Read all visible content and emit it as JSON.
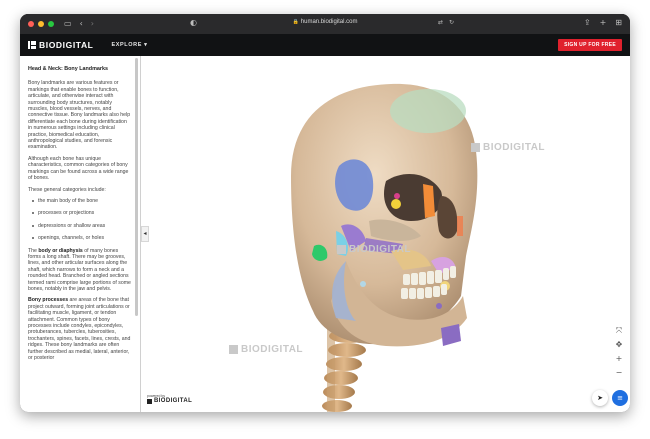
{
  "browser": {
    "url": "human.biodigital.com",
    "traffic_colors": [
      "#ff5f57",
      "#febc2e",
      "#28c840"
    ],
    "icons": [
      "sidebar-toggle-icon",
      "back-icon",
      "forward-icon",
      "shield-icon",
      "translate-icon",
      "reload-icon",
      "share-icon",
      "new-tab-icon",
      "tab-overview-icon"
    ]
  },
  "header": {
    "logo": "BIODIGITAL",
    "explore": "EXPLORE",
    "signup": "SIGN UP FOR FREE",
    "signup_color": "#e0212d"
  },
  "panel": {
    "title": "Head & Neck: Bony Landmarks",
    "p1": "Bony landmarks are various features or markings that enable bones to function, articulate, and otherwise interact with surrounding body structures, notably muscles, blood vessels, nerves, and connective tissue. Bony landmarks also help differentiate each bone during identification in numerous settings including clinical practice, biomedical education, anthropological studies, and forensic examination.",
    "p2": "Although each bone has unique characteristics, common categories of bony markings can be found across a wide range of bones.",
    "p3": "These general categories include:",
    "list": [
      "the main body of the bone",
      "processes or projections",
      "depressions or shallow areas",
      "openings, channels, or holes"
    ],
    "p4_bold": "body or diaphysis",
    "p4_pre": "The ",
    "p4_post": " of many bones forms a long shaft. There may be grooves, lines, and other articular surfaces along the shaft, which narrows to form a neck and a rounded head. Branched or angled sections termed rami comprise large portions of some bones, notably in the jaw and pelvis.",
    "p5_bold": "Bony processes",
    "p5_post": " are areas of the bone that project outward, forming joint articulations or facilitating muscle, ligament, or tendon attachment. Common types of bony processes include condyles, epicondyles, protuberances, tubercles, tuberosities, trochanters, spines, facets, lines, crests, and ridges. These bony landmarks are often further described as medial, lateral, anterior, or posterior"
  },
  "viewer": {
    "watermark": "BIODIGITAL",
    "powered_by": "powered by",
    "powered_brand": "BIODIGITAL",
    "collapse_glyph": "◂",
    "controls": [
      "⤧",
      "✥",
      "+",
      "−"
    ],
    "cursor_glyph": "➤",
    "menu_glyph": "≡"
  }
}
